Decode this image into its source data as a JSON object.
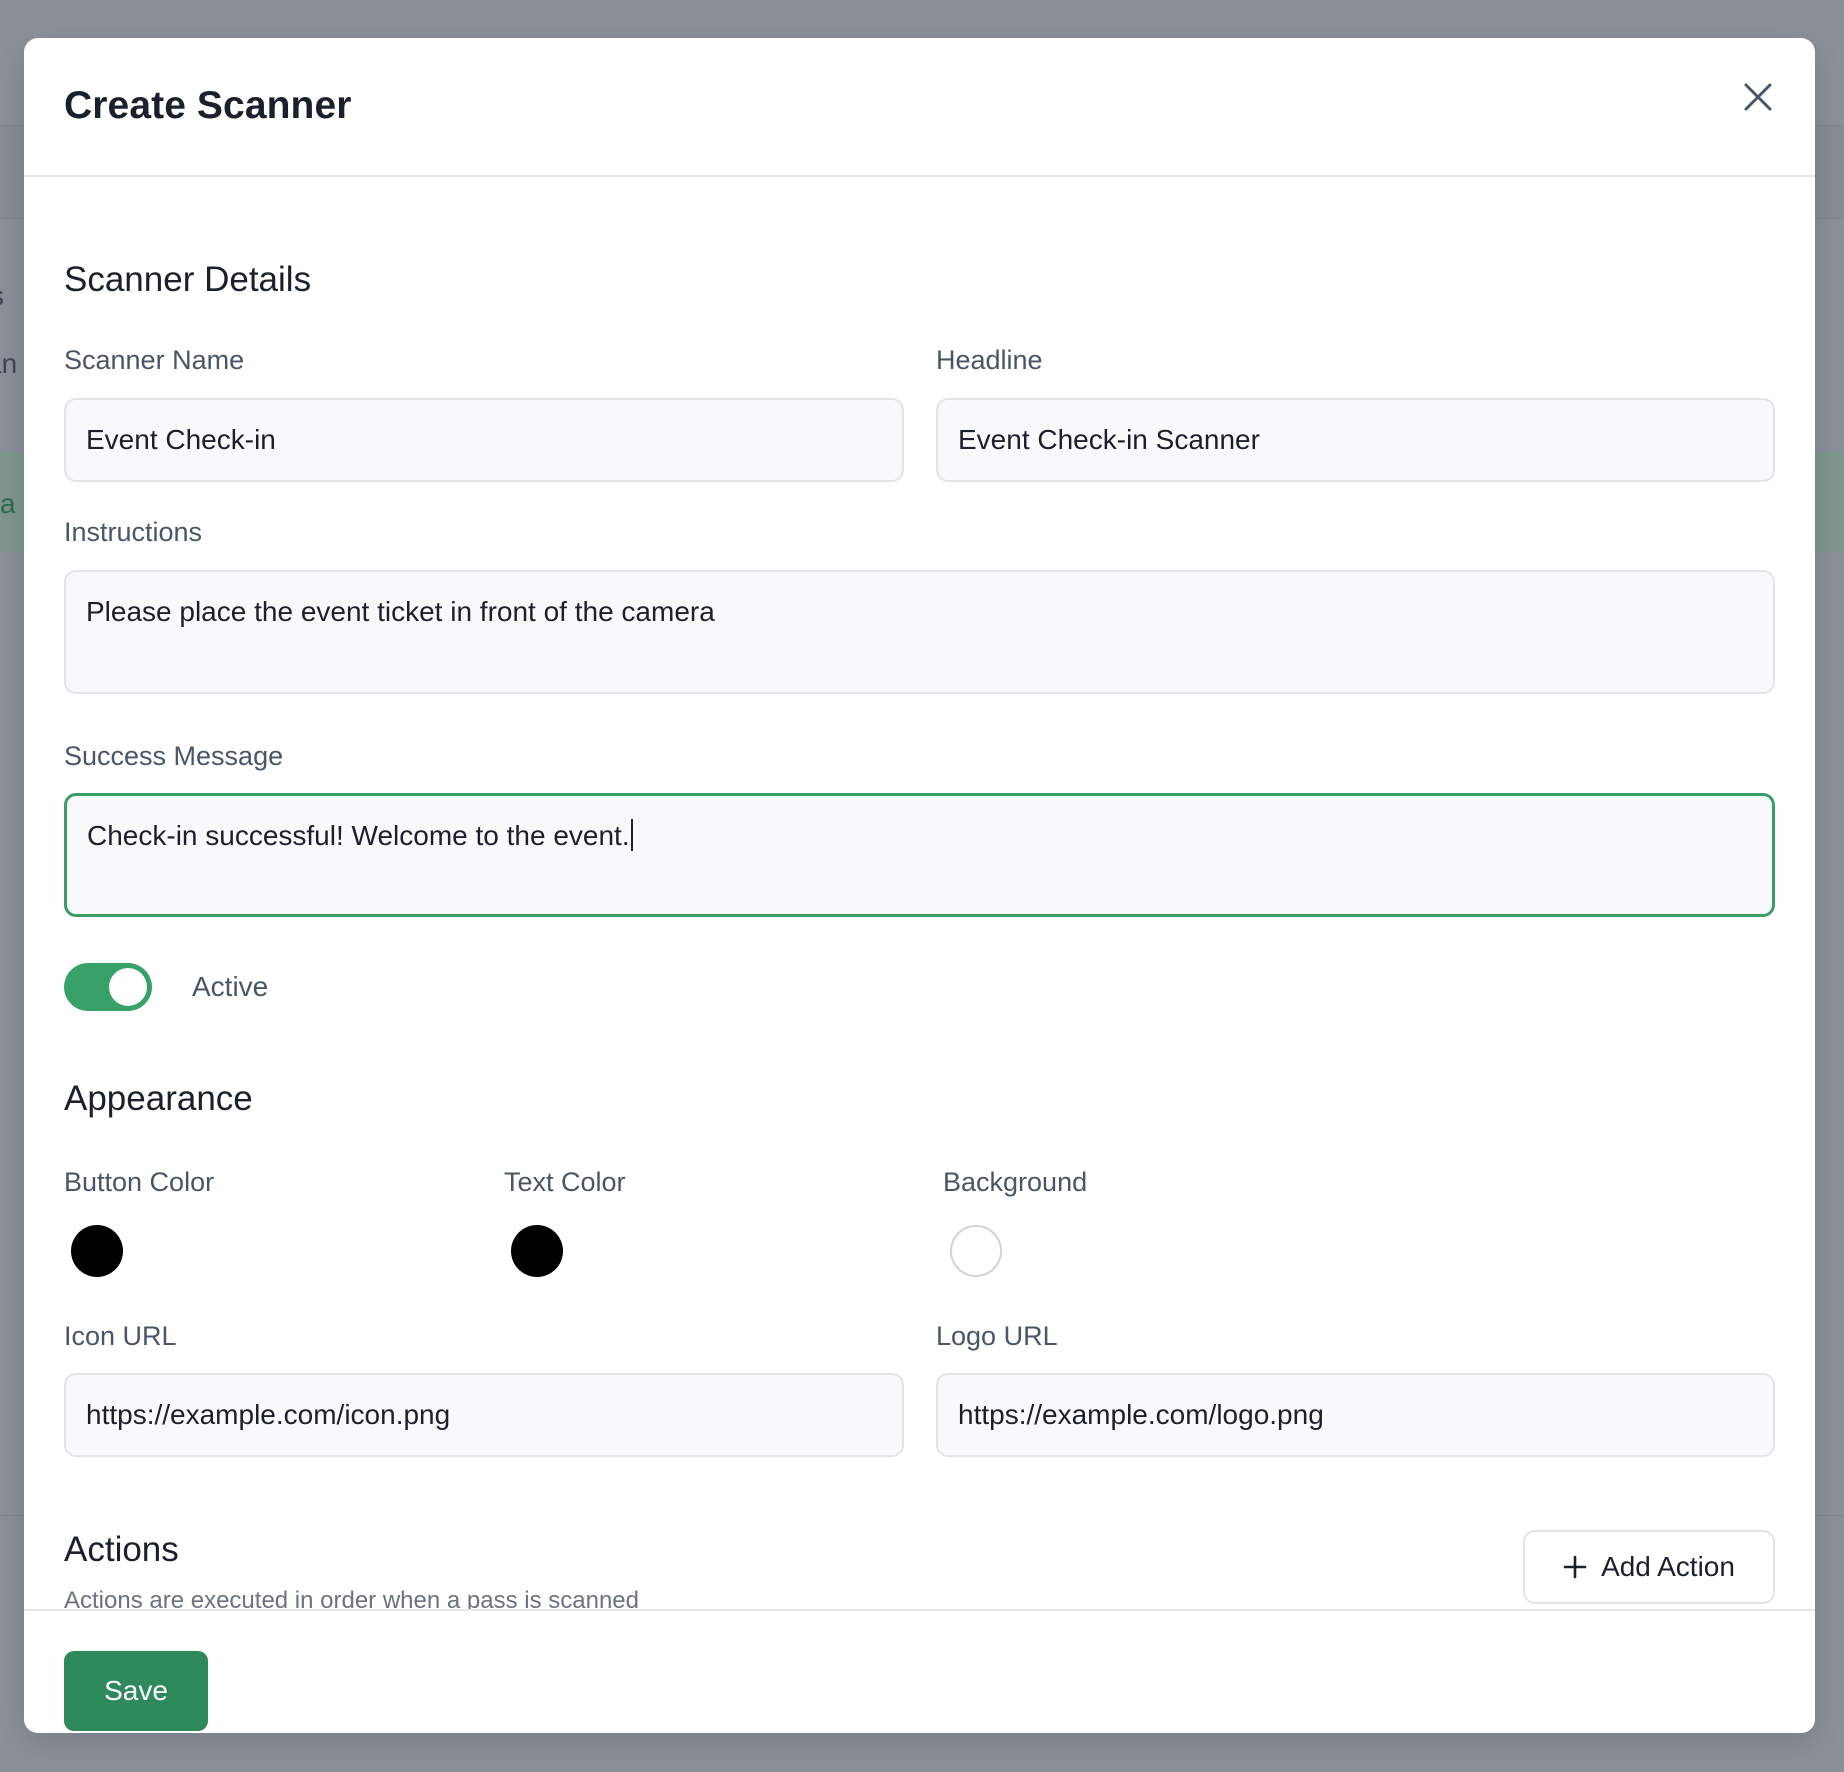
{
  "background": {
    "fragments": [
      "s",
      "an",
      "ca"
    ]
  },
  "modal": {
    "title": "Create Scanner",
    "close_icon": "close-icon"
  },
  "details": {
    "section_title": "Scanner Details",
    "scanner_name": {
      "label": "Scanner Name",
      "value": "Event Check-in"
    },
    "headline": {
      "label": "Headline",
      "value": "Event Check-in Scanner"
    },
    "instructions": {
      "label": "Instructions",
      "value": "Please place the event ticket in front of the camera"
    },
    "success_message": {
      "label": "Success Message",
      "value": "Check-in successful! Welcome to the event."
    },
    "active_toggle": {
      "label": "Active",
      "checked": true
    }
  },
  "appearance": {
    "section_title": "Appearance",
    "button_color": {
      "label": "Button Color",
      "value": "#000000"
    },
    "text_color": {
      "label": "Text Color",
      "value": "#000000"
    },
    "background": {
      "label": "Background",
      "value": "#ffffff"
    },
    "icon_url": {
      "label": "Icon URL",
      "value": "https://example.com/icon.png"
    },
    "logo_url": {
      "label": "Logo URL",
      "value": "https://example.com/logo.png"
    }
  },
  "actions": {
    "section_title": "Actions",
    "description": "Actions are executed in order when a pass is scanned",
    "add_button_label": "Add Action",
    "add_icon": "plus-icon"
  },
  "footer": {
    "save_label": "Save"
  },
  "colors": {
    "accent": "#38a169",
    "save_button": "#2f8a5b",
    "focus_border": "#3b9d66"
  }
}
